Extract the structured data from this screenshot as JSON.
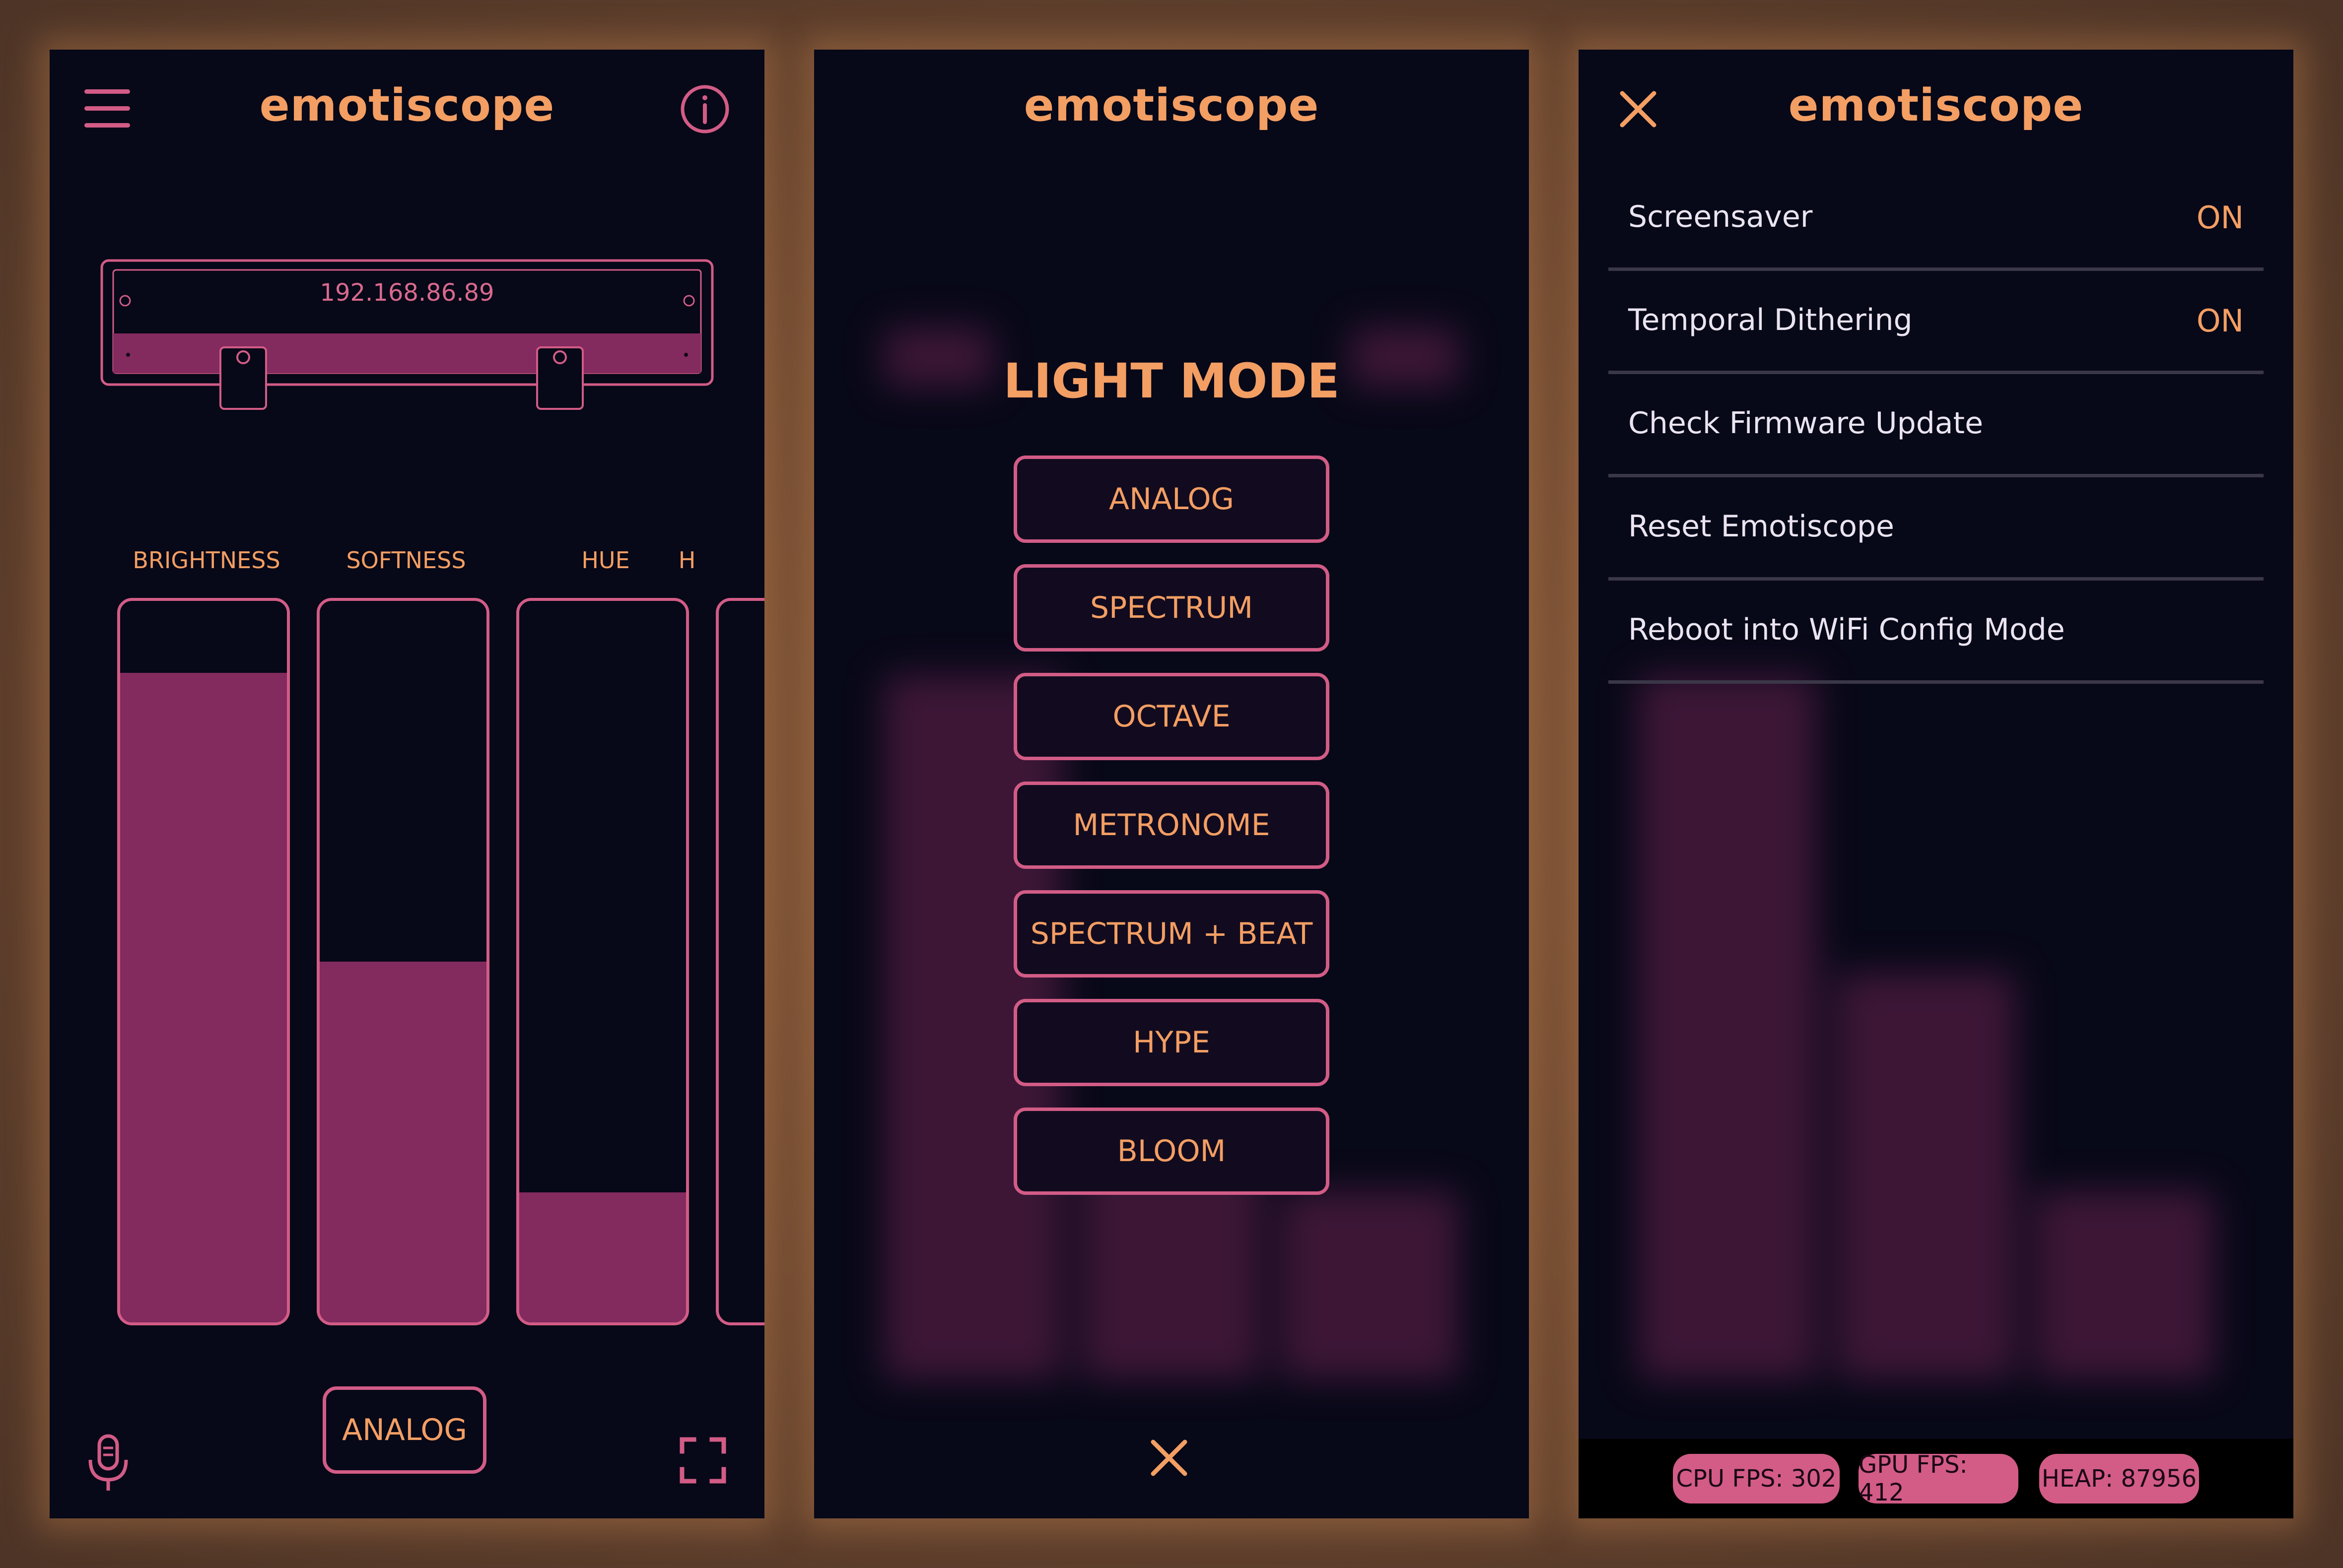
{
  "panel1": {
    "title": "emotiscope",
    "device_ip": "192.168.86.89",
    "sliders": [
      {
        "label": "BRIGHTNESS",
        "value": 0.9
      },
      {
        "label": "SOFTNESS",
        "value": 0.5
      },
      {
        "label": "HUE",
        "value": 0.18
      },
      {
        "label": "H",
        "value": 0.0
      }
    ],
    "mode_button": "ANALOG",
    "icons": [
      "hamburger-menu-icon",
      "info-icon",
      "microphone-icon",
      "fullscreen-icon"
    ]
  },
  "panel2": {
    "title": "emotiscope",
    "heading": "LIGHT MODE",
    "modes": [
      "ANALOG",
      "SPECTRUM",
      "OCTAVE",
      "METRONOME",
      "SPECTRUM + BEAT",
      "HYPE",
      "BLOOM"
    ],
    "icons": [
      "close-icon"
    ]
  },
  "panel3": {
    "title": "emotiscope",
    "settings": [
      {
        "label": "Screensaver",
        "value": "ON"
      },
      {
        "label": "Temporal Dithering",
        "value": "ON"
      },
      {
        "label": "Check Firmware Update",
        "value": ""
      },
      {
        "label": "Reset Emotiscope",
        "value": ""
      },
      {
        "label": "Reboot into WiFi Config Mode",
        "value": ""
      }
    ],
    "stats": {
      "cpu": "CPU FPS: 302",
      "gpu": "GPU FPS: 412",
      "heap": "HEAP: 87956"
    },
    "icons": [
      "close-icon"
    ]
  },
  "colors": {
    "accent": "#f39e63",
    "pink": "#d25c86",
    "fill": "#832a5f",
    "background": "#070818"
  }
}
